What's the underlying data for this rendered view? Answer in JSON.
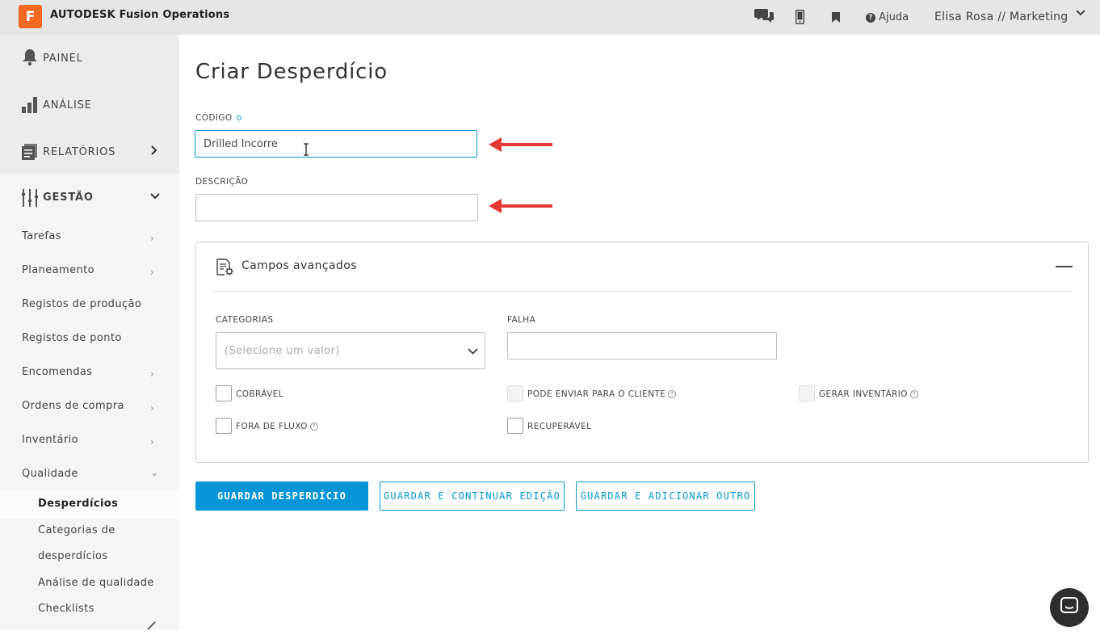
{
  "header": {
    "logo_letter": "F",
    "brand": "AUTODESK Fusion Operations",
    "help_label": "Ajuda",
    "user_label": "Elisa Rosa // Marketing"
  },
  "sidebar": {
    "main": [
      {
        "label": "PAINEL"
      },
      {
        "label": "ANÁLISE"
      },
      {
        "label": "RELATÓRIOS"
      },
      {
        "label": "GESTÃO"
      }
    ],
    "items": [
      {
        "label": "Tarefas"
      },
      {
        "label": "Planeamento"
      },
      {
        "label": "Registos de produção"
      },
      {
        "label": "Registos de ponto"
      },
      {
        "label": "Encomendas"
      },
      {
        "label": "Ordens de compra"
      },
      {
        "label": "Inventário"
      },
      {
        "label": "Qualidade"
      }
    ],
    "quality_sub": [
      {
        "label": "Desperdícios"
      },
      {
        "label": "Categorias de"
      },
      {
        "label": "desperdícios"
      },
      {
        "label": "Análise de qualidade"
      },
      {
        "label": "Checklists"
      }
    ]
  },
  "page": {
    "title": "Criar Desperdício",
    "code_label": "CÓDIGO",
    "code_value": "Drilled Incorre",
    "description_label": "DESCRIÇÃO",
    "description_value": ""
  },
  "advanced": {
    "title": "Campos avançados",
    "categories_label": "CATEGORIAS",
    "categories_placeholder": "(Selecione um valor)",
    "failure_label": "FALHA",
    "checkboxes": {
      "billable": "COBRÁVEL",
      "can_send": "PODE ENVIAR PARA O CLIENTE",
      "gen_inventory": "GERAR INVENTÁRIO",
      "out_of_flow": "FORA DE FLUXO",
      "recoverable": "RECUPERÁVEL"
    }
  },
  "buttons": {
    "save": "GUARDAR DESPERDÍCIO",
    "save_continue": "GUARDAR E CONTINUAR EDIÇÃO",
    "save_add": "GUARDAR E ADICIONAR OUTRO"
  },
  "colors": {
    "accent": "#0696d7",
    "brand_orange": "#f26822",
    "annotation_red": "#e53935"
  }
}
